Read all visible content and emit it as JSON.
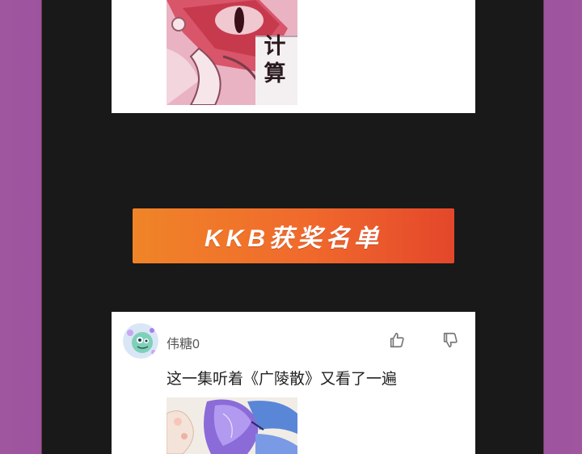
{
  "top_post": {
    "image_caption": "计算"
  },
  "banner": {
    "title": "KKB获奖名单"
  },
  "comment": {
    "username": "伟糖0",
    "text": "这一集听着《广陵散》又看了一遍"
  },
  "icons": {
    "like": "thumbs-up-icon",
    "dislike": "thumbs-down-icon"
  },
  "colors": {
    "background": "#8c4f96",
    "panel": "#191919",
    "banner_start": "#f08428",
    "banner_end": "#e4472b"
  }
}
